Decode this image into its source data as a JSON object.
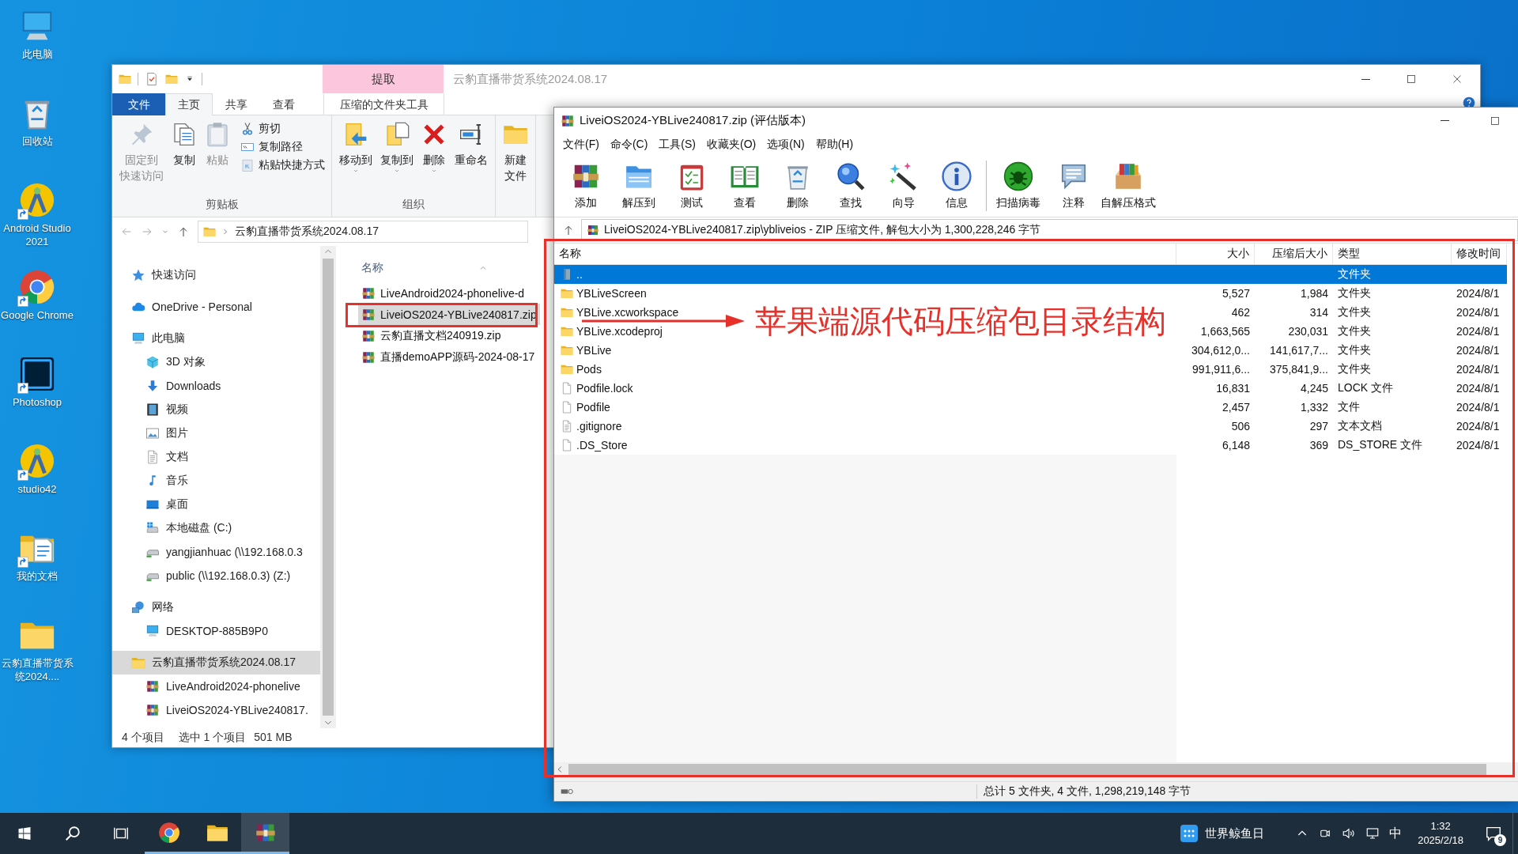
{
  "desktop_icons": [
    {
      "label": "此电脑",
      "kind": "pc",
      "shortcut": false
    },
    {
      "label": "回收站",
      "kind": "bin",
      "shortcut": false
    },
    {
      "label": "Android Studio2021",
      "kind": "studio",
      "shortcut": true
    },
    {
      "label": "Google Chrome",
      "kind": "chrome",
      "shortcut": true
    },
    {
      "label": "Photoshop",
      "kind": "ps",
      "shortcut": true
    },
    {
      "label": "studio42",
      "kind": "studio",
      "shortcut": true
    },
    {
      "label": "我的文档",
      "kind": "docs",
      "shortcut": true
    },
    {
      "label": "云豹直播带货系统2024....",
      "kind": "folder",
      "shortcut": false
    }
  ],
  "explorer": {
    "context_tab": "提取",
    "title": "云豹直播带货系统2024.08.17",
    "ribbon_tabs": [
      {
        "label": "文件",
        "kind": "file",
        "selected": false
      },
      {
        "label": "主页",
        "kind": "tab",
        "selected": true
      },
      {
        "label": "共享",
        "kind": "tab",
        "selected": false
      },
      {
        "label": "查看",
        "kind": "tab",
        "selected": false
      },
      {
        "label": "压缩的文件夹工具",
        "kind": "context",
        "selected": false
      }
    ],
    "ribbon_groups": [
      {
        "label": "剪贴板",
        "items": [
          {
            "kind": "large",
            "lines": [
              "固定到",
              "快速访问"
            ],
            "disabled": true,
            "dropdown": false
          },
          {
            "kind": "large",
            "lines": [
              "复制"
            ],
            "disabled": false,
            "dropdown": false
          },
          {
            "kind": "large",
            "lines": [
              "粘贴"
            ],
            "disabled": true,
            "dropdown": false
          },
          {
            "kind": "small",
            "lines": [
              "剪切"
            ],
            "disabled": false,
            "dropdown": false
          },
          {
            "kind": "small",
            "lines": [
              "复制路径"
            ],
            "disabled": false,
            "dropdown": false
          },
          {
            "kind": "small",
            "lines": [
              "粘贴快捷方式"
            ],
            "disabled": true,
            "dropdown": false
          }
        ]
      },
      {
        "label": "组织",
        "items": [
          {
            "kind": "large",
            "lines": [
              "移动到"
            ],
            "disabled": false,
            "dropdown": true
          },
          {
            "kind": "large",
            "lines": [
              "复制到"
            ],
            "disabled": false,
            "dropdown": true
          },
          {
            "kind": "large",
            "lines": [
              "删除"
            ],
            "disabled": false,
            "dropdown": true
          },
          {
            "kind": "large",
            "lines": [
              "重命名"
            ],
            "disabled": false,
            "dropdown": false
          }
        ]
      },
      {
        "items": [
          {
            "kind": "large",
            "lines": [
              "新建",
              "文件"
            ],
            "disabled": false,
            "dropdown": false
          }
        ]
      }
    ],
    "address": "云豹直播带货系统2024.08.17",
    "nav_tree": [
      {
        "label": "快速访问",
        "kind": "star",
        "selected": false
      },
      {
        "label": "OneDrive - Personal",
        "kind": "cloud",
        "selected": false
      },
      {
        "label": "此电脑",
        "kind": "pc",
        "selected": false,
        "children": [
          {
            "label": "3D 对象",
            "kind": "cube",
            "selected": false
          },
          {
            "label": "Downloads",
            "kind": "down",
            "selected": false
          },
          {
            "label": "视频",
            "kind": "film",
            "selected": false
          },
          {
            "label": "图片",
            "kind": "image",
            "selected": false
          },
          {
            "label": "文档",
            "kind": "textfile",
            "selected": false
          },
          {
            "label": "音乐",
            "kind": "note",
            "selected": false
          },
          {
            "label": "桌面",
            "kind": "desk",
            "selected": false
          },
          {
            "label": "本地磁盘 (C:)",
            "kind": "drive",
            "selected": false
          },
          {
            "label": "yangjianhuac (\\\\192.168.0.3",
            "kind": "netdrive",
            "selected": false
          },
          {
            "label": "public (\\\\192.168.0.3) (Z:)",
            "kind": "netdrive",
            "selected": false
          }
        ]
      },
      {
        "label": "网络",
        "kind": "network",
        "selected": false,
        "children": [
          {
            "label": "DESKTOP-885B9P0",
            "kind": "pc",
            "selected": false
          }
        ]
      },
      {
        "label": "云豹直播带货系统2024.08.17",
        "kind": "folder",
        "selected": true,
        "children": [
          {
            "label": "LiveAndroid2024-phonelive",
            "kind": "rar",
            "selected": false
          },
          {
            "label": "LiveiOS2024-YBLive240817.",
            "kind": "rar",
            "selected": false
          }
        ]
      }
    ],
    "column": "名称",
    "files": [
      {
        "name": "LiveAndroid2024-phonelive-d",
        "selected": false
      },
      {
        "name": "LiveiOS2024-YBLive240817.zip",
        "selected": true
      },
      {
        "name": "云豹直播文档240919.zip",
        "selected": false
      },
      {
        "name": "直播demoAPP源码-2024-08-17",
        "selected": false
      }
    ],
    "status_count": "4 个项目",
    "status_selected": "选中 1 个项目",
    "status_size": "501 MB"
  },
  "winrar": {
    "title": "LiveiOS2024-YBLive240817.zip (评估版本)",
    "menu": [
      "文件(F)",
      "命令(C)",
      "工具(S)",
      "收藏夹(O)",
      "选项(N)",
      "帮助(H)"
    ],
    "tools": [
      {
        "kind": "tool",
        "label": "添加"
      },
      {
        "kind": "tool",
        "label": "解压到"
      },
      {
        "kind": "tool",
        "label": "测试"
      },
      {
        "kind": "tool",
        "label": "查看"
      },
      {
        "kind": "tool",
        "label": "删除"
      },
      {
        "kind": "tool",
        "label": "查找"
      },
      {
        "kind": "tool",
        "label": "向导"
      },
      {
        "kind": "tool",
        "label": "信息"
      },
      {
        "kind": "separator"
      },
      {
        "kind": "tool",
        "label": "扫描病毒"
      },
      {
        "kind": "tool",
        "label": "注释"
      },
      {
        "kind": "tool",
        "label": "自解压格式"
      }
    ],
    "path": "LiveiOS2024-YBLive240817.zip\\ybliveios - ZIP 压缩文件, 解包大小为 1,300,228,246 字节",
    "columns": [
      "名称",
      "大小",
      "压缩后大小",
      "类型",
      "修改时间"
    ],
    "rows": [
      {
        "kind": "parent",
        "name": "..",
        "type": "文件夹",
        "selected": true
      },
      {
        "kind": "folder",
        "name": "YBLiveScreen",
        "size": "5,527",
        "packed": "1,984",
        "type": "文件夹",
        "modified": "2024/8/1",
        "selected": false
      },
      {
        "kind": "folder",
        "name": "YBLive.xcworkspace",
        "size": "462",
        "packed": "314",
        "type": "文件夹",
        "modified": "2024/8/1",
        "selected": false
      },
      {
        "kind": "folder",
        "name": "YBLive.xcodeproj",
        "size": "1,663,565",
        "packed": "230,031",
        "type": "文件夹",
        "modified": "2024/8/1",
        "selected": false
      },
      {
        "kind": "folder",
        "name": "YBLive",
        "size": "304,612,0...",
        "packed": "141,617,7...",
        "type": "文件夹",
        "modified": "2024/8/1",
        "selected": false
      },
      {
        "kind": "folder",
        "name": "Pods",
        "size": "991,911,6...",
        "packed": "375,841,9...",
        "type": "文件夹",
        "modified": "2024/8/1",
        "selected": false
      },
      {
        "kind": "file",
        "name": "Podfile.lock",
        "size": "16,831",
        "packed": "4,245",
        "type": "LOCK 文件",
        "modified": "2024/8/1",
        "selected": false
      },
      {
        "kind": "file",
        "name": "Podfile",
        "size": "2,457",
        "packed": "1,332",
        "type": "文件",
        "modified": "2024/8/1",
        "selected": false
      },
      {
        "kind": "text",
        "name": ".gitignore",
        "size": "506",
        "packed": "297",
        "type": "文本文档",
        "modified": "2024/8/1",
        "selected": false
      },
      {
        "kind": "file",
        "name": ".DS_Store",
        "size": "6,148",
        "packed": "369",
        "type": "DS_STORE 文件",
        "modified": "2024/8/1",
        "selected": false
      }
    ],
    "status": "总计 5 文件夹, 4 文件, 1,298,219,148 字节"
  },
  "annotation": {
    "callout": "苹果端源代码压缩包目录结构"
  },
  "taskbar": {
    "apps": [
      {
        "kind": "chrome",
        "selected": false
      },
      {
        "kind": "explorer",
        "selected": false
      },
      {
        "kind": "winrar",
        "selected": true
      }
    ],
    "news": "世界鲸鱼日",
    "ime": "中",
    "time": "1:32",
    "date": "2025/2/18",
    "notifications": "9"
  }
}
